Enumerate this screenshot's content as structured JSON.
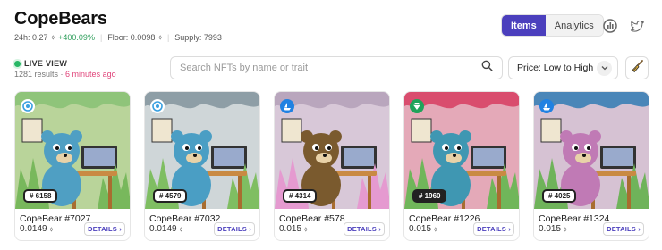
{
  "collection": {
    "title": "CopeBears",
    "stats": {
      "change_label": "24h: 0.27",
      "change_pct": "+400.09%",
      "floor_label": "Floor: 0.0098",
      "supply_label": "Supply: 7993"
    }
  },
  "view_toggle": {
    "items": "Items",
    "analytics": "Analytics"
  },
  "live": {
    "label": "LIVE VIEW",
    "results": "1281 results",
    "updated": "6 minutes ago"
  },
  "search": {
    "placeholder": "Search NFTs by name or trait",
    "value": ""
  },
  "sort": {
    "selected": "Price: Low to High"
  },
  "colors": {
    "accent": "#4b3fbd",
    "live": "#27b765",
    "up": "#2e9e5b",
    "ago": "#e0447a"
  },
  "cards": [
    {
      "name": "CopeBear #7027",
      "rank": "# 6158",
      "price": "0.0149",
      "details": "DETAILS ›",
      "sky": "#8fc47a",
      "bear": "#4f9fc3",
      "fire": "#78b85c",
      "wall": "#b9d49a",
      "badge": "marketplace-swirl-icon"
    },
    {
      "name": "CopeBear #7032",
      "rank": "# 4579",
      "price": "0.0149",
      "details": "DETAILS ›",
      "sky": "#8e9ea6",
      "bear": "#4a9ec4",
      "fire": "#7fbe62",
      "wall": "#cfd6d8",
      "badge": "marketplace-swirl-icon"
    },
    {
      "name": "CopeBear #578",
      "rank": "# 4314",
      "price": "0.015",
      "details": "DETAILS ›",
      "sky": "#b9a6bd",
      "bear": "#7a5a2e",
      "fire": "#e59ad0",
      "wall": "#d8c8d8",
      "badge": "ship-icon"
    },
    {
      "name": "CopeBear #1226",
      "rank": "# 1960",
      "price": "0.015",
      "details": "DETAILS ›",
      "sky": "#d94d6e",
      "bear": "#3f97b2",
      "fire": "#70b65a",
      "wall": "#e4a9b8",
      "badge": "diamond-icon"
    },
    {
      "name": "CopeBear #1324",
      "rank": "# 4025",
      "price": "0.015",
      "details": "DETAILS ›",
      "sky": "#4a86b8",
      "bear": "#c07ab5",
      "fire": "#6fb35a",
      "wall": "#d6c2d3",
      "badge": "ship-icon"
    }
  ]
}
